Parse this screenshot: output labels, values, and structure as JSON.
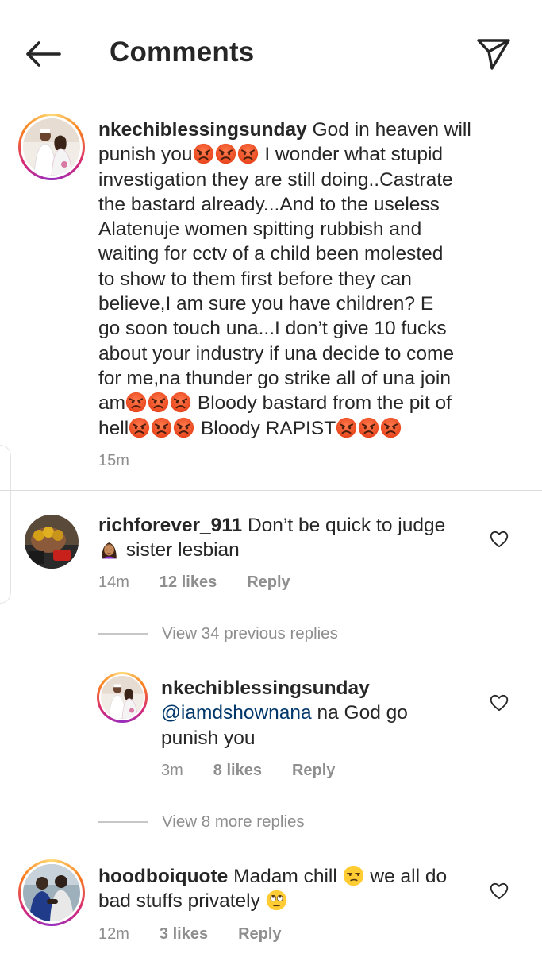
{
  "header": {
    "title": "Comments"
  },
  "comments": [
    {
      "username": "nkechiblessingsunday",
      "lines": {
        "l1": "God in heaven will",
        "l2a": "punish you",
        "l2b": " I wonder what stupid",
        "l3": "investigation they are still doing..Castrate",
        "l4": "the bastard already...And to the useless",
        "l5": "Alatenuje women spitting rubbish and",
        "l6": "waiting for cctv of a child been molested",
        "l7": "to show to them first before they can",
        "l8": "believe,I am sure you have children? E",
        "l9": "go soon touch una...I don’t give 10 fucks",
        "l10": "about your industry if una decide to come",
        "l11": "for me,na thunder go strike all of una join",
        "l12a": "am",
        "l12b": " Bloody bastard from the pit of",
        "l13a": "hell",
        "l13b": " Bloody RAPIST"
      },
      "time": "15m",
      "emoji": "angry-face"
    },
    {
      "username": "richforever_911",
      "line1": "Don’t be quick to judge",
      "line2": " sister lesbian",
      "time": "14m",
      "likes": "12 likes",
      "reply": "Reply"
    },
    {
      "username": "nkechiblessingsunday",
      "mention": "@iamdshownana",
      "line1": " na God go",
      "line2": "punish you",
      "time": "3m",
      "likes": "8 likes",
      "reply": "Reply"
    },
    {
      "username": "hoodboiquote",
      "line1a": "Madam chill ",
      "line1b": " we all do",
      "line2": "bad stuffs privately ",
      "time": "12m",
      "likes": "3 likes",
      "reply": "Reply"
    }
  ],
  "view_replies": [
    {
      "label": "View 34 previous replies"
    },
    {
      "label": "View 8 more replies"
    }
  ],
  "colors": {
    "text": "#262626",
    "secondary": "#8e8e8e",
    "mention": "#00376b",
    "divider": "#dbdbdb"
  }
}
